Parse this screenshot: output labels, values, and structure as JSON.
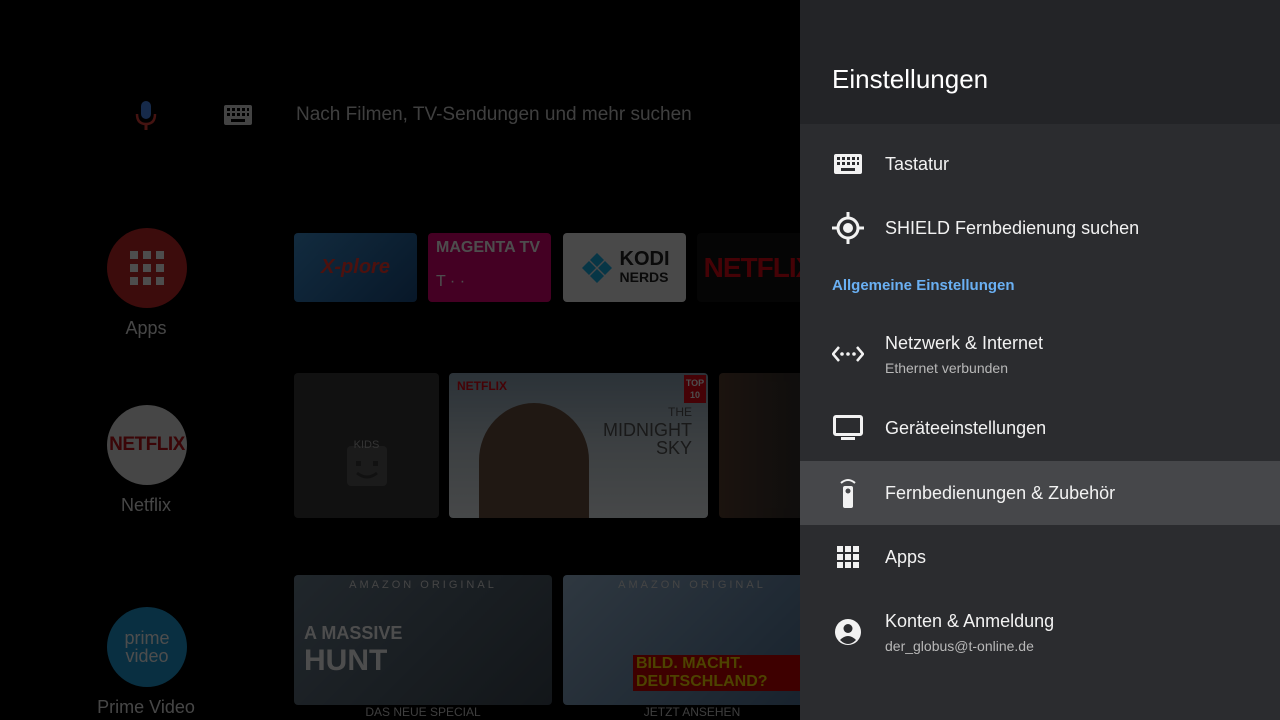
{
  "home": {
    "search": {
      "placeholder": "Nach Filmen, TV-Sendungen und mehr suchen"
    },
    "channels": [
      {
        "label": "Apps"
      },
      {
        "label": "Netflix",
        "logo": "NETFLIX"
      },
      {
        "label": "Prime Video",
        "logo_line1": "prime",
        "logo_line2": "video"
      }
    ],
    "favorite_apps": [
      {
        "name": "Xplore",
        "logo": "X-plore"
      },
      {
        "name": "Magenta TV",
        "logo": "MAGENTA TV",
        "sub": "T · ·"
      },
      {
        "name": "Kodi Nerds",
        "logo": "KODI",
        "sub": "NERDS"
      },
      {
        "name": "Netflix",
        "logo": "NETFLIX"
      }
    ],
    "netflix_row": {
      "kids": "KIDS",
      "netflix_badge": "NETFLIX",
      "top10": "TOP 10",
      "title_line1": "THE",
      "title_line2": "MIDNIGHT",
      "title_line3": "SKY"
    },
    "prime_row": [
      {
        "badge": "AMAZON ORIGINAL",
        "title_line1": "A MASSIVE",
        "title_line2": "HUNT",
        "caption": "DAS NEUE SPECIAL"
      },
      {
        "badge": "AMAZON ORIGINAL",
        "title": "BILD. MACHT. DEUTSCHLAND?",
        "caption": "JETZT ANSEHEN"
      }
    ]
  },
  "settings": {
    "title": "Einstellungen",
    "items_top": [
      {
        "title": "Tastatur",
        "icon": "keyboard-icon"
      },
      {
        "title": "SHIELD Fernbedienung suchen",
        "icon": "locate-icon"
      }
    ],
    "section_label": "Allgemeine Einstellungen",
    "items_general": [
      {
        "title": "Netzwerk & Internet",
        "subtitle": "Ethernet verbunden",
        "icon": "network-icon"
      },
      {
        "title": "Geräteeinstellungen",
        "icon": "tv-icon"
      },
      {
        "title": "Fernbedienungen & Zubehör",
        "icon": "remote-icon",
        "focused": true
      },
      {
        "title": "Apps",
        "icon": "apps-grid-icon"
      },
      {
        "title": "Konten & Anmeldung",
        "subtitle": "der_globus@t-online.de",
        "icon": "account-icon"
      }
    ]
  },
  "colors": {
    "panel_bg": "#2b2c2f",
    "panel_header_bg": "#232427",
    "focus_bg": "#46474a",
    "section_accent": "#6ab0f3"
  }
}
